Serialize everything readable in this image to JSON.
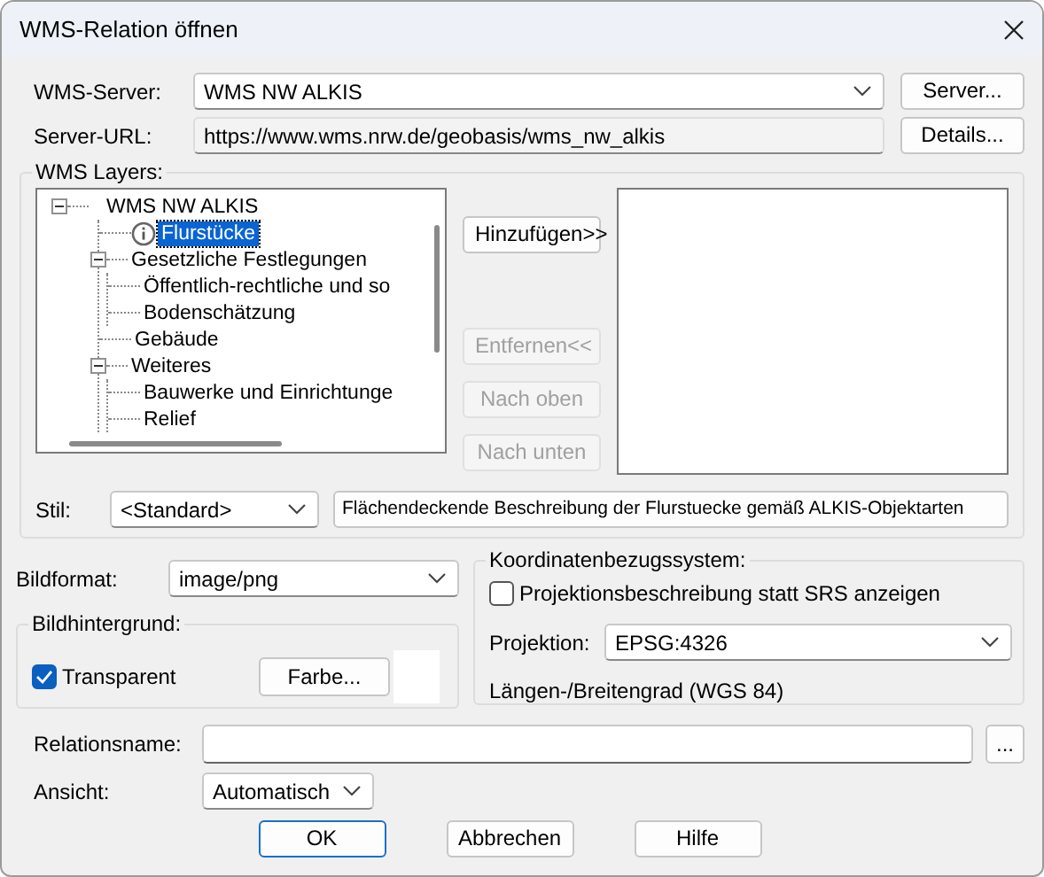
{
  "window": {
    "title": "WMS-Relation öffnen"
  },
  "server": {
    "label": "WMS-Server:",
    "value": "WMS NW ALKIS",
    "button": "Server..."
  },
  "url": {
    "label": "Server-URL:",
    "value": "https://www.wms.nrw.de/geobasis/wms_nw_alkis",
    "button": "Details..."
  },
  "layers": {
    "title": "WMS Layers:",
    "tree": [
      {
        "label": "WMS NW ALKIS",
        "selected": false,
        "info": false,
        "expanded": true,
        "children": [
          {
            "label": "Flurstücke",
            "selected": true,
            "info": true
          },
          {
            "label": "Gesetzliche Festlegungen",
            "selected": false,
            "info": false,
            "expanded": true,
            "children": [
              {
                "label": "Öffentlich-rechtliche und so",
                "selected": false,
                "info": false
              },
              {
                "label": "Bodenschätzung",
                "selected": false,
                "info": false
              }
            ]
          },
          {
            "label": "Gebäude",
            "selected": false,
            "info": false
          },
          {
            "label": "Weiteres",
            "selected": false,
            "info": false,
            "expanded": true,
            "children": [
              {
                "label": "Bauwerke und Einrichtunge",
                "selected": false,
                "info": false
              },
              {
                "label": "Relief",
                "selected": false,
                "info": false
              }
            ]
          }
        ]
      }
    ],
    "buttons": [
      {
        "label": "Hinzufügen>>",
        "disabled": false
      },
      {
        "label": "Entfernen<<",
        "disabled": true
      },
      {
        "label": "Nach oben",
        "disabled": true
      },
      {
        "label": "Nach unten",
        "disabled": true
      }
    ],
    "style": {
      "label": "Stil:",
      "value": "<Standard>",
      "description": "Flächendeckende Beschreibung der Flurstuecke gemäß ALKIS-Objektarten"
    }
  },
  "image": {
    "format_label": "Bildformat:",
    "format": "image/png",
    "background": {
      "title": "Bildhintergrund:",
      "transparent": {
        "label": "Transparent",
        "checked": true
      },
      "color_button": "Farbe...",
      "color": "#ffffff"
    }
  },
  "crs": {
    "title": "Koordinatenbezugssystem:",
    "show_description": {
      "label": "Projektionsbeschreibung statt SRS anzeigen",
      "checked": false
    },
    "projection_label": "Projektion:",
    "projection": "EPSG:4326",
    "description": "Längen-/Breitengrad (WGS 84)"
  },
  "relation": {
    "label": "Relationsname:",
    "button": "..."
  },
  "view": {
    "label": "Ansicht:",
    "value": "Automatisch"
  },
  "buttons": [
    {
      "label": "OK",
      "default": true
    },
    {
      "label": "Abbrechen",
      "default": false
    },
    {
      "label": "Hilfe",
      "default": false
    }
  ]
}
